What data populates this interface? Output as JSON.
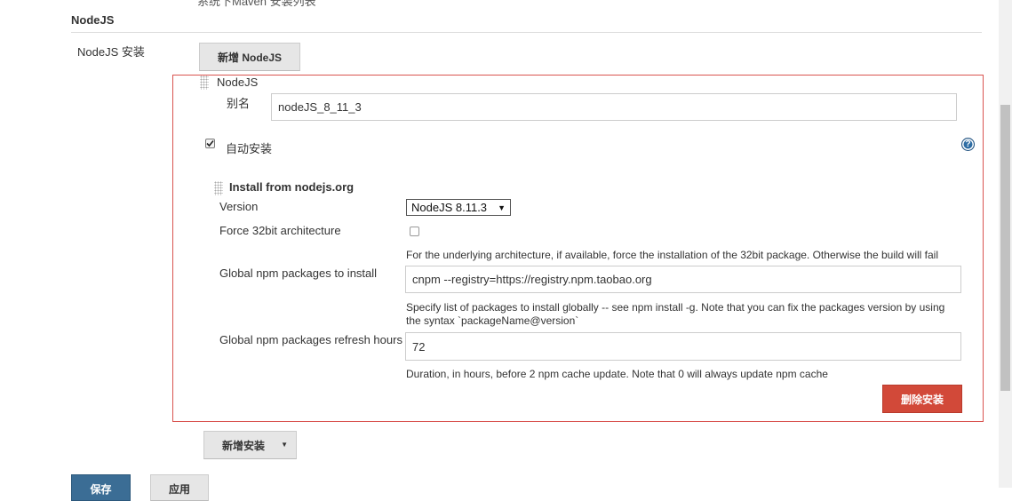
{
  "top_cut_text": "系统下Maven 安装列表",
  "section": {
    "title": "NodeJS"
  },
  "nodejs_install": {
    "label": "NodeJS 安装",
    "add_button": "新增 NodeJS",
    "installation": {
      "header": "NodeJS",
      "alias_label": "别名",
      "alias_value": "nodeJS_8_11_3",
      "auto_install_label": "自动安装",
      "auto_install_checked": true,
      "help_icon": "question-circle-icon",
      "installer": {
        "title": "Install from nodejs.org",
        "version_label": "Version",
        "version_value": "NodeJS 8.11.3",
        "force32_label": "Force 32bit architecture",
        "force32_checked": false,
        "force32_note": "For the underlying architecture, if available, force the installation of the 32bit package. Otherwise the build will fail",
        "global_packages_label": "Global npm packages to install",
        "global_packages_value": "cnpm --registry=https://registry.npm.taobao.org",
        "global_packages_note": "Specify list of packages to install globally -- see npm install -g. Note that you can fix the packages version by using the syntax `packageName@version`",
        "refresh_hours_label": "Global npm packages refresh hours",
        "refresh_hours_value": "72",
        "refresh_hours_note": "Duration, in hours, before 2 npm cache update. Note that 0 will always update npm cache"
      },
      "delete_button": "删除安装"
    },
    "add_installer_button": "新增安装"
  },
  "footer": {
    "save_button": "保存",
    "apply_button": "应用"
  },
  "colors": {
    "delete_red": "#d24939",
    "box_border": "#d9534f",
    "save_blue": "#3b6d95"
  }
}
